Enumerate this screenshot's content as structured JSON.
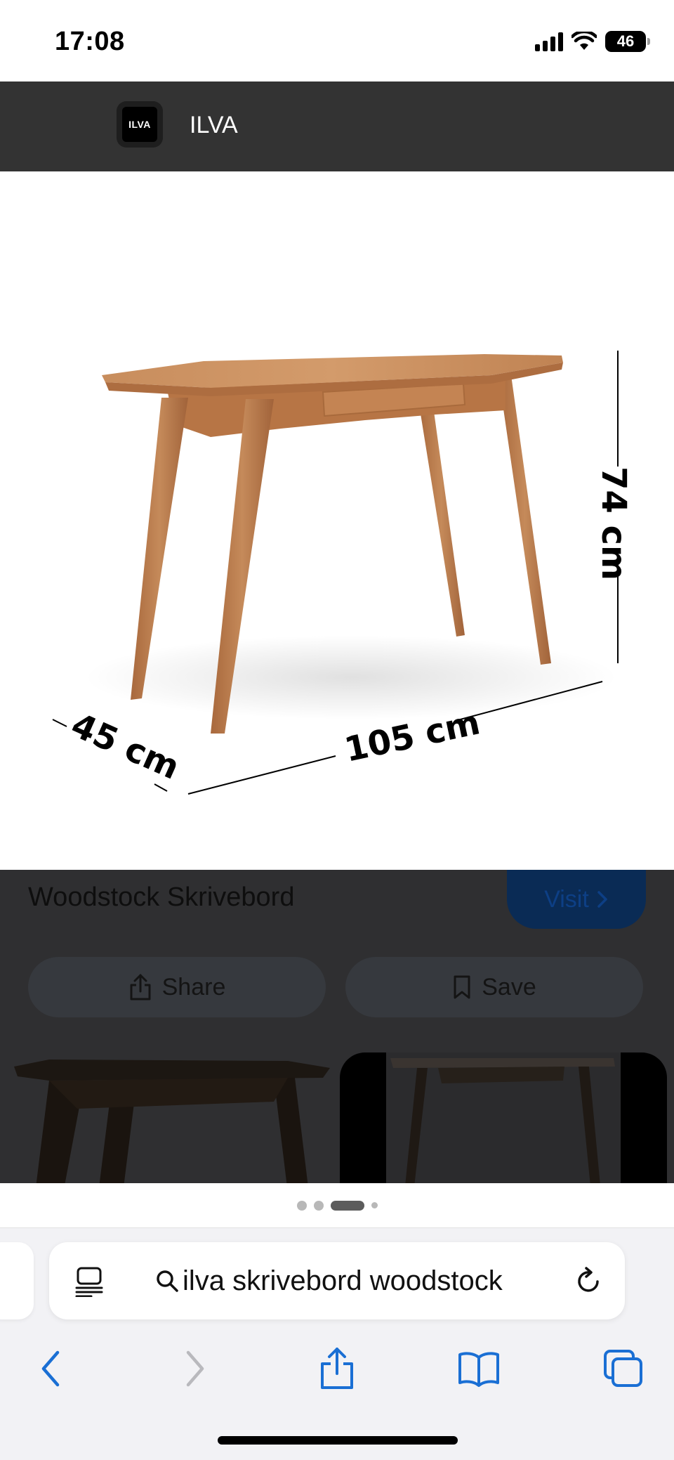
{
  "status_bar": {
    "time": "17:08",
    "battery": "46"
  },
  "source": {
    "name": "ILVA",
    "logo_text": "ILVA"
  },
  "product_image": {
    "dimension_depth": "45 cm",
    "dimension_width": "105 cm",
    "dimension_height": "74 cm"
  },
  "product": {
    "title": "Woodstock Skrivebord",
    "visit_label": "Visit",
    "share_label": "Share",
    "save_label": "Save"
  },
  "pager": {
    "total": 4,
    "active_index": 2
  },
  "browser": {
    "search_query": "ilva skrivebord woodstock"
  },
  "colors": {
    "accent": "#1a6fd4",
    "dark_panel": "#2f2f31",
    "wood": "#c58a5a"
  },
  "icons": {
    "share": "share-icon",
    "save": "bookmark-icon",
    "reader": "reader-icon",
    "search": "search-icon",
    "reload": "reload-icon",
    "back": "back-chevron-icon",
    "forward": "forward-chevron-icon",
    "toolbar_share": "share-icon",
    "bookmarks": "book-icon",
    "tabs": "tabs-icon"
  }
}
